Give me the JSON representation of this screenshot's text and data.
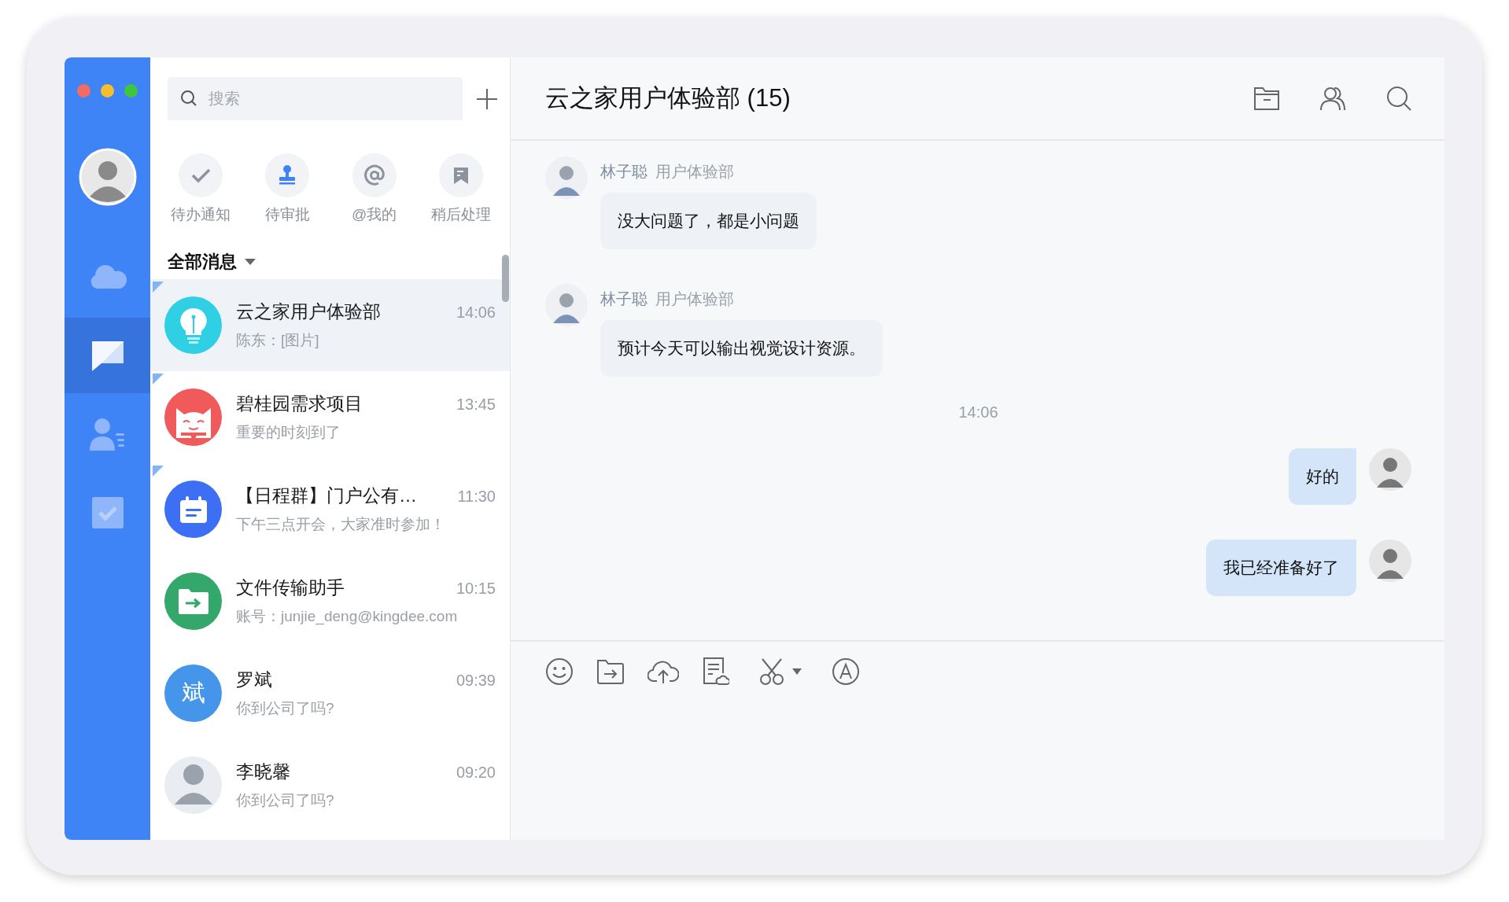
{
  "sidebar": {
    "items": [
      {
        "kind": "cloud",
        "selected": false
      },
      {
        "kind": "chat",
        "selected": true
      },
      {
        "kind": "contacts",
        "selected": false
      },
      {
        "kind": "tasks",
        "selected": false
      }
    ]
  },
  "search": {
    "placeholder": "搜索"
  },
  "shortcuts": [
    {
      "kind": "check",
      "label": "待办通知",
      "highlighted": false
    },
    {
      "kind": "stamp",
      "label": "待审批",
      "highlighted": true
    },
    {
      "kind": "at",
      "label": "@我的",
      "highlighted": false
    },
    {
      "kind": "bookmark",
      "label": "稍后处理",
      "highlighted": false
    }
  ],
  "filter": {
    "label": "全部消息"
  },
  "conversations": [
    {
      "name": "云之家用户体验部",
      "preview": "陈东：[图片]",
      "time": "14:06",
      "selected": true,
      "pinned": true,
      "avatar": {
        "kind": "bulb",
        "color": "#2fd0e3"
      }
    },
    {
      "name": "碧桂园需求项目",
      "preview": "重要的时刻到了",
      "time": "13:45",
      "selected": false,
      "pinned": true,
      "avatar": {
        "kind": "cat",
        "color": "#f05a5a"
      }
    },
    {
      "name": "【日程群】门户公有…",
      "preview": "下午三点开会，大家准时参加！",
      "time": "11:30",
      "selected": false,
      "pinned": true,
      "avatar": {
        "kind": "calendar",
        "color": "#3d6ff5"
      }
    },
    {
      "name": "文件传输助手",
      "preview": "账号：junjie_deng@kingdee.com",
      "time": "10:15",
      "selected": false,
      "pinned": false,
      "avatar": {
        "kind": "folder",
        "color": "#33a86a"
      }
    },
    {
      "name": "罗斌",
      "preview": "你到公司了吗?",
      "time": "09:39",
      "selected": false,
      "pinned": false,
      "avatar": {
        "kind": "text",
        "color": "#4595ea",
        "text": "斌"
      }
    },
    {
      "name": "李晓馨",
      "preview": "你到公司了吗?",
      "time": "09:20",
      "selected": false,
      "pinned": false,
      "avatar": {
        "kind": "photo",
        "color": "#e9ecf0"
      }
    }
  ],
  "chat": {
    "title": "云之家用户体验部 (15)",
    "messages": [
      {
        "kind": "incoming",
        "sender": "林子聪",
        "department": "用户体验部",
        "text": "没大问题了，都是小问题"
      },
      {
        "kind": "incoming",
        "sender": "林子聪",
        "department": "用户体验部",
        "text": "预计今天可以输出视觉设计资源。"
      },
      {
        "kind": "time",
        "text": "14:06"
      },
      {
        "kind": "outgoing",
        "text": "好的"
      },
      {
        "kind": "outgoing",
        "text": "我已经准备好了"
      }
    ]
  }
}
